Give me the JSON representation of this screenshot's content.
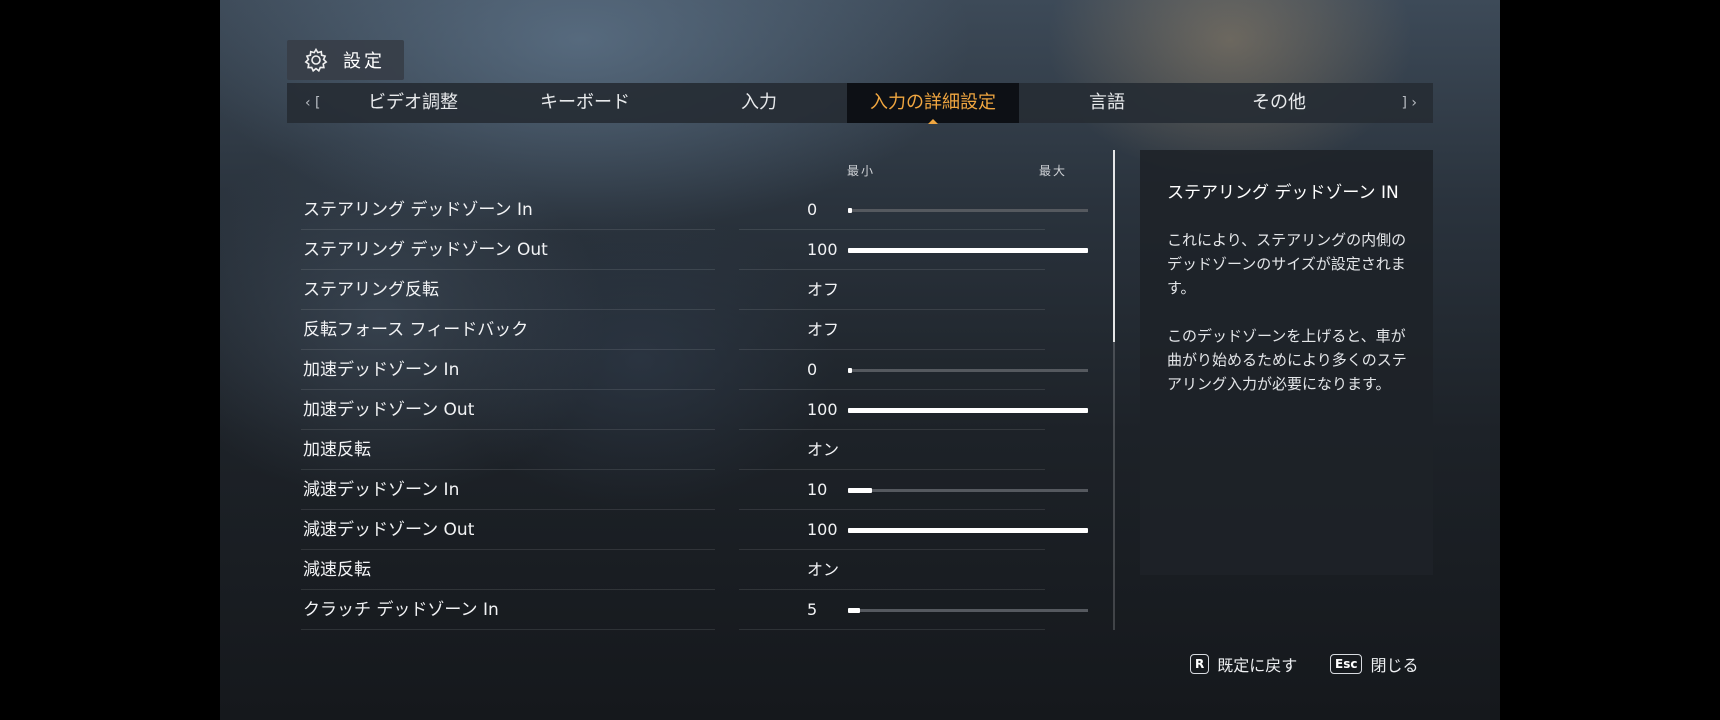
{
  "header": {
    "title": "設定",
    "icon": "gear-icon"
  },
  "tabs": {
    "prev": "‹ [",
    "next": "] ›",
    "items": [
      {
        "label": "ビデオ調整",
        "active": false
      },
      {
        "label": "キーボード",
        "active": false
      },
      {
        "label": "入力",
        "active": false
      },
      {
        "label": "入力の詳細設定",
        "active": true
      },
      {
        "label": "言語",
        "active": false
      },
      {
        "label": "その他",
        "active": false
      }
    ]
  },
  "columns": {
    "min": "最小",
    "max": "最大"
  },
  "settings": [
    {
      "label": "ステアリング デッドゾーン In",
      "value": "0",
      "type": "slider",
      "level": 0
    },
    {
      "label": "ステアリング デッドゾーン Out",
      "value": "100",
      "type": "slider",
      "level": 100
    },
    {
      "label": "ステアリング反転",
      "value": "オフ",
      "type": "toggle"
    },
    {
      "label": "反転フォース フィードバック",
      "value": "オフ",
      "type": "toggle"
    },
    {
      "label": "加速デッドゾーン In",
      "value": "0",
      "type": "slider",
      "level": 0
    },
    {
      "label": "加速デッドゾーン Out",
      "value": "100",
      "type": "slider",
      "level": 100
    },
    {
      "label": "加速反転",
      "value": "オン",
      "type": "toggle"
    },
    {
      "label": "減速デッドゾーン In",
      "value": "10",
      "type": "slider",
      "level": 10
    },
    {
      "label": "減速デッドゾーン Out",
      "value": "100",
      "type": "slider",
      "level": 100
    },
    {
      "label": "減速反転",
      "value": "オン",
      "type": "toggle"
    },
    {
      "label": "クラッチ デッドゾーン In",
      "value": "5",
      "type": "slider",
      "level": 5
    }
  ],
  "scroll": {
    "position_percent": 0,
    "visible_fraction": 0.4
  },
  "info": {
    "title": "ステアリング デッドゾーン IN",
    "paragraphs": [
      "これにより、ステアリングの内側のデッドゾーンのサイズが設定されます。",
      "このデッドゾーンを上げると、車が曲がり始めるためにより多くのステアリング入力が必要になります。"
    ]
  },
  "footer": {
    "reset": {
      "key": "R",
      "label": "既定に戻す"
    },
    "close": {
      "key": "Esc",
      "label": "閉じる"
    }
  },
  "colors": {
    "accent": "#f0a640",
    "slider_fill": "#ffffff",
    "slider_track": "#55595f"
  }
}
